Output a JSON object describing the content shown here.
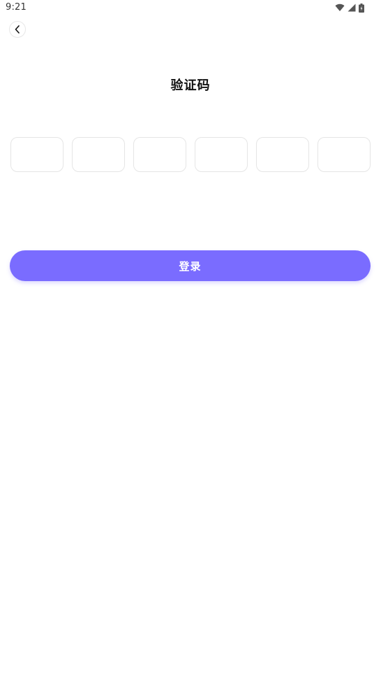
{
  "status_bar": {
    "time": "9:21",
    "icons": [
      "wifi-icon",
      "signal-icon",
      "battery-icon"
    ]
  },
  "header": {
    "back_icon": "chevron-left-icon",
    "title": "验证码"
  },
  "code_input": {
    "length": 6,
    "digits": [
      "",
      "",
      "",
      "",
      "",
      ""
    ]
  },
  "actions": {
    "login_label": "登录"
  },
  "colors": {
    "accent": "#7a6cff",
    "box_border": "#e5e5e5",
    "title_text": "#111111"
  }
}
